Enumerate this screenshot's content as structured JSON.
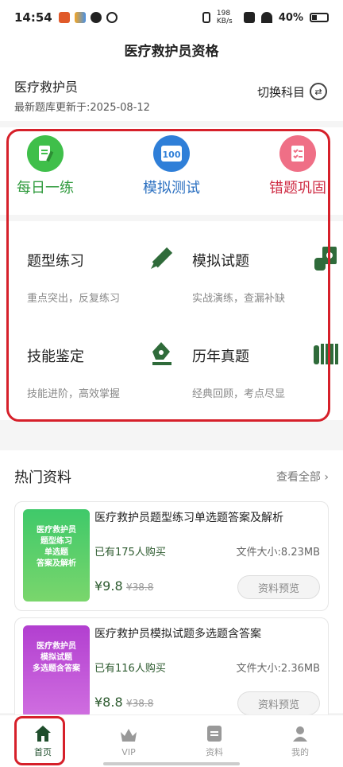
{
  "status": {
    "time": "14:54",
    "speed": "198 KB/s",
    "battery": "40%"
  },
  "app": {
    "title": "医疗救护员资格"
  },
  "subject": {
    "name": "医疗救护员",
    "update": "最新题库更新于:2025-08-12",
    "switch_label": "切换科目"
  },
  "quick": [
    {
      "label": "每日一练",
      "icon": "pencil-paper-icon",
      "color": "#3a9a3a"
    },
    {
      "label": "模拟测试",
      "icon": "score-100-icon",
      "color": "#2a74c9"
    },
    {
      "label": "错题巩固",
      "icon": "checklist-icon",
      "color": "#d3304a"
    }
  ],
  "features": [
    {
      "title": "题型练习",
      "desc": "重点突出，反复练习",
      "icon": "pencil-icon"
    },
    {
      "title": "模拟试题",
      "desc": "实战演练，查漏补缺",
      "icon": "money-hand-icon"
    },
    {
      "title": "技能鉴定",
      "desc": "技能进阶，高效掌握",
      "icon": "pen-nib-icon"
    },
    {
      "title": "历年真题",
      "desc": "经典回顾，考点尽显",
      "icon": "book-stack-icon"
    }
  ],
  "hot": {
    "title": "热门资料",
    "more": "查看全部",
    "items": [
      {
        "cover": [
          "医疗救护员",
          "题型练习",
          "单选题",
          "答案及解析"
        ],
        "title": "医疗救护员题型练习单选题答案及解析",
        "buyers": "已有175人购买",
        "size": "文件大小:8.23MB",
        "price": "¥9.8",
        "old": "¥38.8",
        "preview": "资料预览"
      },
      {
        "cover": [
          "医疗救护员",
          "模拟试题",
          "多选题含答案"
        ],
        "title": "医疗救护员模拟试题多选题含答案",
        "buyers": "已有116人购买",
        "size": "文件大小:2.36MB",
        "price": "¥8.8",
        "old": "¥38.8",
        "preview": "资料预览"
      }
    ]
  },
  "tabs": [
    {
      "label": "首页"
    },
    {
      "label": "VIP"
    },
    {
      "label": "资料"
    },
    {
      "label": "我的"
    }
  ],
  "colors": {
    "brand": "#1e4d2b",
    "highlight": "#d6202a"
  }
}
